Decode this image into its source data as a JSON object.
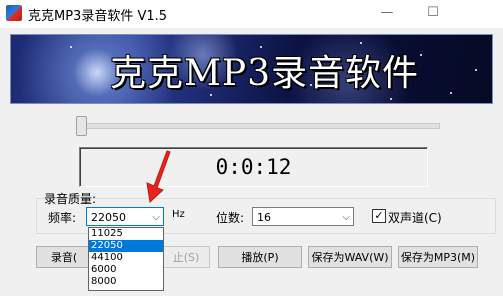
{
  "window": {
    "title": "克克MP3录音软件 V1.5",
    "minimize_glyph": "—",
    "maximize_glyph": "☐"
  },
  "banner": {
    "text": "克克MP3录音软件"
  },
  "timer": {
    "value": "0:0:12"
  },
  "quality": {
    "group_label": "录音质量:",
    "freq_label": "频率:",
    "freq_value": "22050",
    "freq_unit": "Hz",
    "bits_label": "位数:",
    "bits_value": "16",
    "stereo_label": "双声道(C)",
    "stereo_checked": true,
    "freq_options": [
      "11025",
      "22050",
      "44100",
      "6000",
      "8000"
    ],
    "freq_selected_index": 1
  },
  "buttons": {
    "record": "录音(",
    "stop": "止(S)",
    "play": "播放(P)",
    "save_wav": "保存为WAV(W)",
    "save_mp3": "保存为MP3(M)"
  },
  "colors": {
    "selection": "#0078d7",
    "annotation_arrow": "#e8231b"
  },
  "icons": {
    "app": "app-icon",
    "check": "check-icon",
    "dropdown": "chevron-down-icon"
  }
}
